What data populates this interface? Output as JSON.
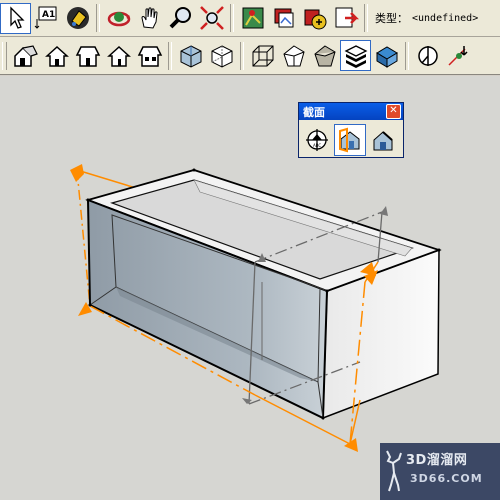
{
  "toolbar_top": {
    "tools": [
      "select-arrow",
      "text-A1",
      "paint-bucket",
      "orbit",
      "pan-hand",
      "zoom",
      "zoom-extents",
      "map-position",
      "import-photo",
      "component-export",
      "send-to-layout"
    ],
    "active_tool": "select-arrow",
    "type_label": "类型：",
    "type_value": "<undefined>"
  },
  "toolbar_views": {
    "views": [
      "iso",
      "top",
      "front",
      "right",
      "back",
      "left"
    ],
    "styles": [
      "wireframe-style",
      "hidden-line-style",
      "shaded-style",
      "shaded-textures-style",
      "monochrome-style",
      "xray-style"
    ],
    "active_style": "monochrome-style",
    "section_tools": [
      "section-plane-tool",
      "section-cut-tool"
    ]
  },
  "section_panel": {
    "title": "截面",
    "close_label": "✕",
    "buttons": [
      "add-section-plane",
      "display-section-planes",
      "display-section-cuts"
    ],
    "active_button": "display-section-planes"
  },
  "colors": {
    "section_orange": "#ff8c00",
    "box_inner": "#a7b3bd",
    "box_outer": "#f1f1f1",
    "background": "#d6d6d2"
  },
  "watermark": {
    "title": "3D溜溜网",
    "subtitle": "3D66.COM"
  }
}
